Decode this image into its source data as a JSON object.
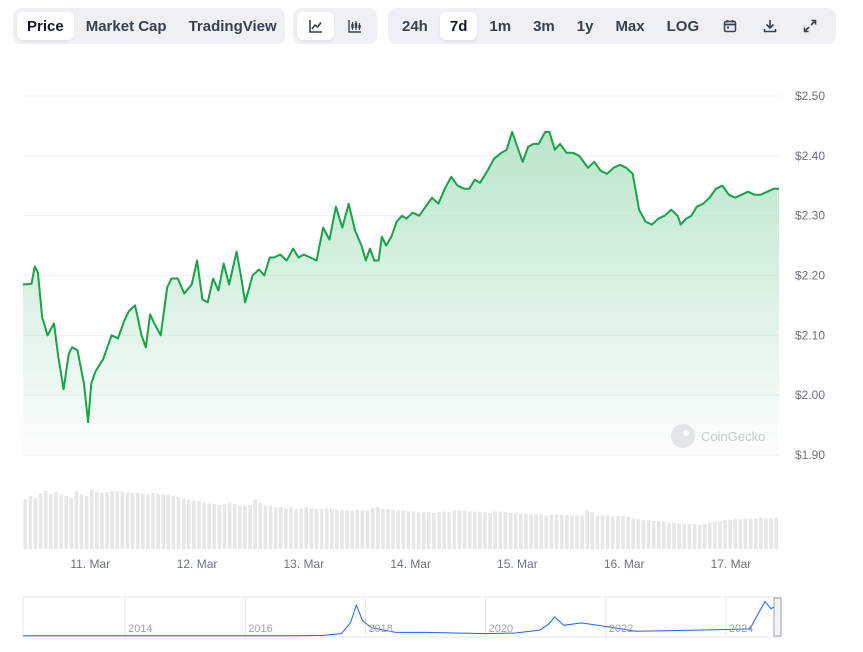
{
  "tabs": {
    "price": "Price",
    "market_cap": "Market Cap",
    "tradingview": "TradingView",
    "active": "Price"
  },
  "chart_type_toggle": {
    "line_icon": "line-chart-icon",
    "candle_icon": "candlestick-chart-icon",
    "active": "line"
  },
  "ranges": {
    "items": [
      "24h",
      "7d",
      "1m",
      "3m",
      "1y",
      "Max",
      "LOG"
    ],
    "active": "7d",
    "icons": [
      "calendar-icon",
      "download-icon",
      "expand-icon"
    ]
  },
  "watermark": "CoinGecko",
  "colors": {
    "line": "#16a34a",
    "area_top": "#b7e4c7",
    "volume_bar": "#e5e7eb",
    "grid": "#eef0f2",
    "overview_line": "#2563eb"
  },
  "chart_data": [
    {
      "type": "area",
      "title": "",
      "x_ticks": [
        "11. Mar",
        "12. Mar",
        "13. Mar",
        "14. Mar",
        "15. Mar",
        "16. Mar",
        "17. Mar"
      ],
      "y_ticks": [
        "$2.50",
        "$2.40",
        "$2.30",
        "$2.20",
        "$2.10",
        "$2.00",
        "$1.90"
      ],
      "ylim": [
        1.9,
        2.5
      ],
      "y_axis_position": "right",
      "grid": true,
      "x_range_days": [
        10.37,
        17.45
      ],
      "series": [
        {
          "x": [
            10.37,
            10.45,
            10.48,
            10.51,
            10.55,
            10.6,
            10.66,
            10.7,
            10.75,
            10.8,
            10.83,
            10.88,
            10.94,
            10.98,
            11.01,
            11.05,
            11.12,
            11.2,
            11.26,
            11.32,
            11.36,
            11.42,
            11.48,
            11.52,
            11.56,
            11.6,
            11.66,
            11.72,
            11.76,
            11.82,
            11.88,
            11.95,
            12.0,
            12.05,
            12.1,
            12.15,
            12.2,
            12.25,
            12.3,
            12.37,
            12.42,
            12.45,
            12.52,
            12.58,
            12.63,
            12.68,
            12.72,
            12.78,
            12.84,
            12.9,
            12.95,
            13.0,
            13.06,
            13.12,
            13.18,
            13.24,
            13.3,
            13.36,
            13.42,
            13.48,
            13.54,
            13.58,
            13.62,
            13.66,
            13.7,
            13.73,
            13.77,
            13.82,
            13.87,
            13.92,
            13.96,
            14.02,
            14.08,
            14.14,
            14.2,
            14.26,
            14.32,
            14.38,
            14.44,
            14.5,
            14.55,
            14.6,
            14.65,
            14.72,
            14.78,
            14.85,
            14.9,
            14.95,
            15.0,
            15.05,
            15.1,
            15.15,
            15.2,
            15.23,
            15.26,
            15.3,
            15.35,
            15.4,
            15.46,
            15.52,
            15.58,
            15.62,
            15.66,
            15.72,
            15.78,
            15.84,
            15.9,
            15.96,
            16.02,
            16.08,
            16.14,
            16.2,
            16.26,
            16.32,
            16.38,
            16.44,
            16.5,
            16.53,
            16.58,
            16.63,
            16.68,
            16.74,
            16.8,
            16.86,
            16.92,
            16.98,
            17.04,
            17.1,
            17.16,
            17.22,
            17.28,
            17.34,
            17.4,
            17.45
          ],
          "y": [
            2.185,
            2.186,
            2.215,
            2.205,
            2.13,
            2.1,
            2.12,
            2.065,
            2.01,
            2.07,
            2.08,
            2.075,
            2.02,
            1.955,
            2.02,
            2.04,
            2.06,
            2.1,
            2.095,
            2.125,
            2.14,
            2.15,
            2.1,
            2.08,
            2.135,
            2.12,
            2.1,
            2.18,
            2.195,
            2.195,
            2.17,
            2.185,
            2.225,
            2.16,
            2.155,
            2.195,
            2.175,
            2.22,
            2.185,
            2.24,
            2.19,
            2.155,
            2.2,
            2.21,
            2.2,
            2.23,
            2.23,
            2.235,
            2.225,
            2.245,
            2.23,
            2.235,
            2.23,
            2.225,
            2.28,
            2.26,
            2.315,
            2.28,
            2.32,
            2.275,
            2.25,
            2.225,
            2.245,
            2.225,
            2.225,
            2.265,
            2.25,
            2.265,
            2.29,
            2.3,
            2.295,
            2.305,
            2.3,
            2.315,
            2.33,
            2.32,
            2.345,
            2.365,
            2.35,
            2.345,
            2.345,
            2.36,
            2.355,
            2.375,
            2.395,
            2.405,
            2.41,
            2.44,
            2.415,
            2.39,
            2.415,
            2.42,
            2.42,
            2.43,
            2.44,
            2.44,
            2.41,
            2.42,
            2.405,
            2.405,
            2.4,
            2.39,
            2.38,
            2.39,
            2.375,
            2.37,
            2.38,
            2.385,
            2.38,
            2.37,
            2.31,
            2.29,
            2.285,
            2.295,
            2.3,
            2.31,
            2.3,
            2.285,
            2.295,
            2.3,
            2.315,
            2.32,
            2.33,
            2.345,
            2.35,
            2.335,
            2.33,
            2.335,
            2.34,
            2.335,
            2.335,
            2.34,
            2.345,
            2.345
          ]
        }
      ]
    },
    {
      "type": "bar",
      "title": "",
      "description_label": "volume",
      "values": [
        0.62,
        0.66,
        0.64,
        0.7,
        0.73,
        0.69,
        0.71,
        0.68,
        0.66,
        0.64,
        0.72,
        0.68,
        0.66,
        0.74,
        0.71,
        0.7,
        0.71,
        0.72,
        0.72,
        0.72,
        0.71,
        0.7,
        0.7,
        0.69,
        0.68,
        0.7,
        0.69,
        0.68,
        0.68,
        0.66,
        0.65,
        0.63,
        0.62,
        0.61,
        0.6,
        0.58,
        0.57,
        0.56,
        0.55,
        0.56,
        0.58,
        0.56,
        0.54,
        0.54,
        0.55,
        0.62,
        0.58,
        0.54,
        0.54,
        0.52,
        0.52,
        0.51,
        0.52,
        0.5,
        0.51,
        0.52,
        0.5,
        0.5,
        0.5,
        0.51,
        0.51,
        0.49,
        0.49,
        0.48,
        0.48,
        0.49,
        0.48,
        0.48,
        0.51,
        0.52,
        0.5,
        0.5,
        0.49,
        0.48,
        0.48,
        0.47,
        0.47,
        0.46,
        0.46,
        0.46,
        0.45,
        0.46,
        0.47,
        0.46,
        0.48,
        0.48,
        0.48,
        0.47,
        0.47,
        0.46,
        0.46,
        0.45,
        0.47,
        0.47,
        0.46,
        0.45,
        0.45,
        0.44,
        0.44,
        0.43,
        0.43,
        0.43,
        0.42,
        0.43,
        0.43,
        0.43,
        0.42,
        0.42,
        0.42,
        0.42,
        0.48,
        0.46,
        0.42,
        0.42,
        0.42,
        0.41,
        0.41,
        0.41,
        0.4,
        0.38,
        0.37,
        0.36,
        0.36,
        0.35,
        0.35,
        0.34,
        0.33,
        0.33,
        0.32,
        0.31,
        0.31,
        0.31,
        0.3,
        0.31,
        0.33,
        0.34,
        0.35,
        0.36,
        0.36,
        0.38,
        0.37,
        0.38,
        0.38,
        0.38,
        0.39,
        0.38,
        0.38,
        0.39
      ]
    },
    {
      "type": "line",
      "title": "",
      "x_ticks": [
        "2014",
        "2016",
        "2018",
        "2020",
        "2022",
        "2024"
      ],
      "x_range_years": [
        2012.3,
        2024.9
      ],
      "ylim": [
        0,
        3.2
      ],
      "series": [
        {
          "x": [
            2012.3,
            2013.0,
            2014.0,
            2015.0,
            2016.0,
            2016.8,
            2017.3,
            2017.6,
            2017.75,
            2017.85,
            2017.95,
            2018.1,
            2018.5,
            2019.0,
            2019.5,
            2020.0,
            2020.5,
            2020.9,
            2021.05,
            2021.15,
            2021.3,
            2021.6,
            2022.0,
            2022.5,
            2023.0,
            2023.5,
            2024.0,
            2024.4,
            2024.55,
            2024.65,
            2024.75,
            2024.85,
            2024.9
          ],
          "y": [
            0.02,
            0.02,
            0.02,
            0.02,
            0.02,
            0.02,
            0.05,
            0.2,
            1.1,
            2.6,
            1.3,
            0.7,
            0.3,
            0.3,
            0.25,
            0.2,
            0.25,
            0.5,
            1.0,
            1.6,
            0.9,
            1.1,
            0.8,
            0.4,
            0.45,
            0.5,
            0.55,
            0.6,
            2.0,
            2.9,
            2.3,
            2.6,
            2.3
          ]
        }
      ]
    }
  ]
}
